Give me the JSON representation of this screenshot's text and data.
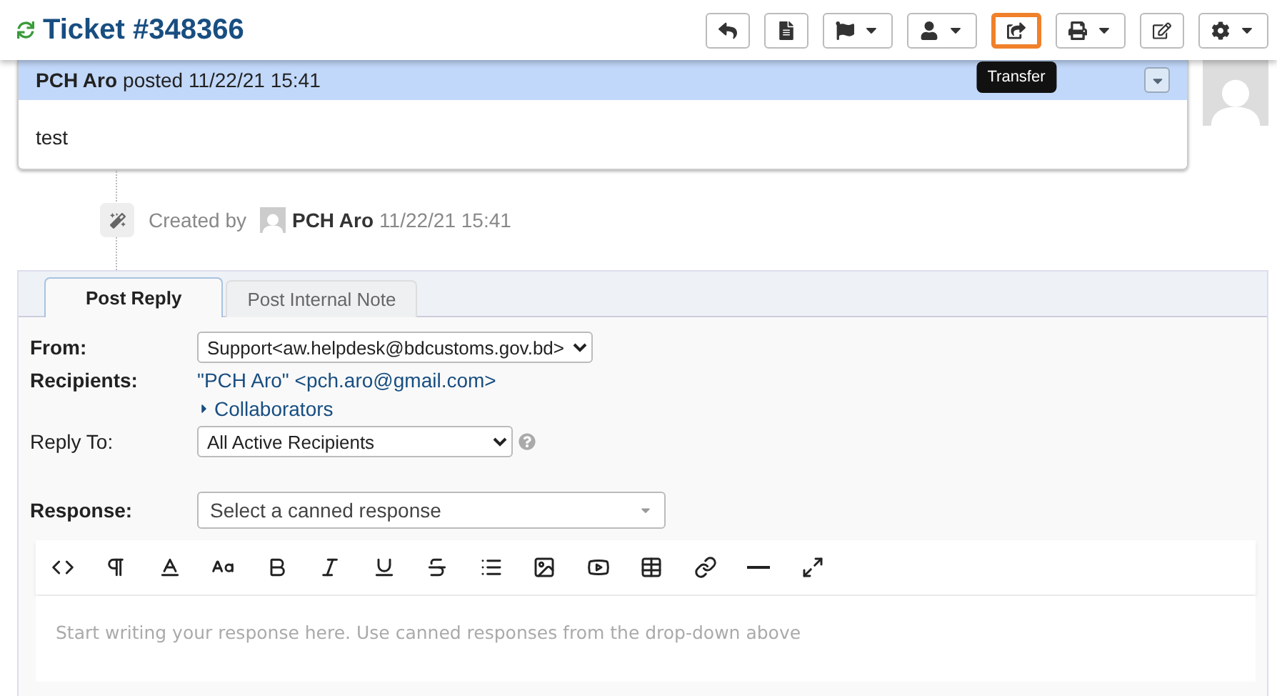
{
  "header": {
    "title": "Ticket #348366",
    "tooltip": "Transfer",
    "actions": [
      {
        "kind": "reply",
        "dropdown": false,
        "selected": false
      },
      {
        "kind": "document",
        "dropdown": false,
        "selected": false
      },
      {
        "kind": "flag",
        "dropdown": true,
        "selected": false
      },
      {
        "kind": "user",
        "dropdown": true,
        "selected": false
      },
      {
        "kind": "transfer",
        "dropdown": false,
        "selected": true
      },
      {
        "kind": "print",
        "dropdown": true,
        "selected": false
      },
      {
        "kind": "edit",
        "dropdown": false,
        "selected": false
      },
      {
        "kind": "settings",
        "dropdown": true,
        "selected": false
      }
    ]
  },
  "thread": {
    "entry": {
      "author": "PCH Aro",
      "posted": "posted 11/22/21 15:41",
      "body": "test"
    },
    "event": {
      "label": "Created by",
      "author": "PCH Aro",
      "time": "11/22/21 15:41"
    }
  },
  "composer": {
    "tabs": [
      {
        "label": "Post Reply",
        "selected": true
      },
      {
        "label": "Post Internal Note",
        "selected": false
      }
    ],
    "from": {
      "label": "From:",
      "value": "Support<aw.helpdesk@bdcustoms.gov.bd>"
    },
    "recipients": {
      "label": "Recipients:",
      "value": "\"PCH Aro\" <pch.aro@gmail.com>",
      "collaborators": "Collaborators"
    },
    "reply_to": {
      "label": "Reply To:",
      "value": "All Active Recipients"
    },
    "response": {
      "label": "Response:",
      "placeholder": "Select a canned response"
    },
    "editor": {
      "placeholder": "Start writing your response here. Use canned responses from the drop-down above",
      "tools": [
        {
          "kind": "code"
        },
        {
          "kind": "paragraph"
        },
        {
          "kind": "color"
        },
        {
          "kind": "size"
        },
        {
          "kind": "bold"
        },
        {
          "kind": "italic"
        },
        {
          "kind": "underline"
        },
        {
          "kind": "strike"
        },
        {
          "kind": "list"
        },
        {
          "kind": "image"
        },
        {
          "kind": "video"
        },
        {
          "kind": "table"
        },
        {
          "kind": "link"
        },
        {
          "kind": "rule"
        },
        {
          "kind": "fullscreen"
        }
      ]
    }
  }
}
